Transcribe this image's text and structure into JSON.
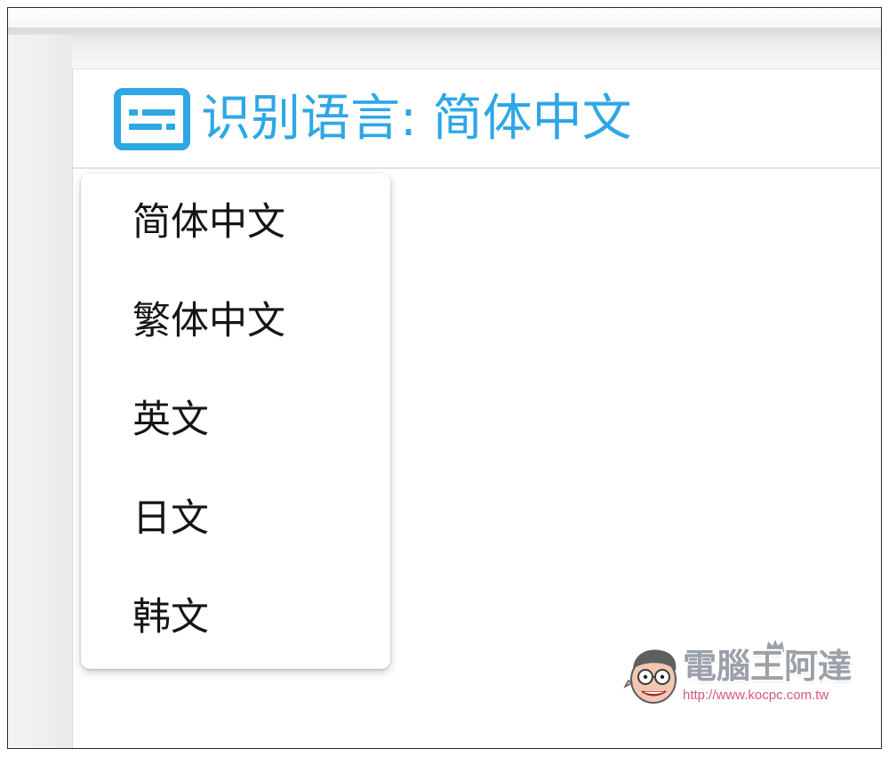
{
  "header": {
    "icon": "subtitles-icon",
    "label": "识别语言: 简体中文",
    "accent_color": "#2da7e6"
  },
  "language_menu": {
    "items": [
      {
        "label": "简体中文"
      },
      {
        "label": "繁体中文"
      },
      {
        "label": "英文"
      },
      {
        "label": "日文"
      },
      {
        "label": "韩文"
      }
    ]
  },
  "watermark": {
    "brand": "電腦王阿達",
    "url": "http://www.kocpc.com.tw",
    "mascot_icon": "mascot-face-icon",
    "crown_icon": "crown-icon"
  }
}
